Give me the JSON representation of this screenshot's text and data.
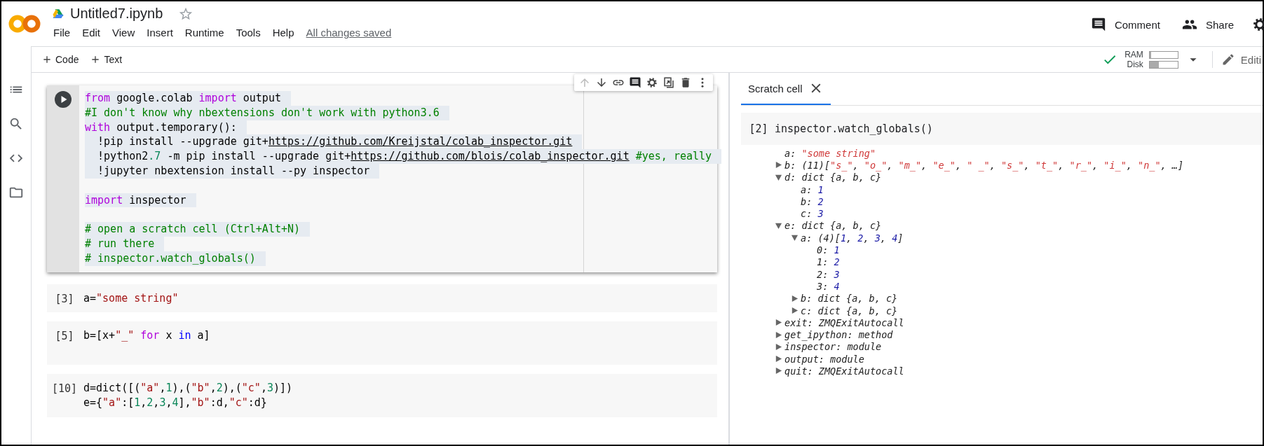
{
  "header": {
    "title": "Untitled7.ipynb",
    "starred": false,
    "menu": [
      "File",
      "Edit",
      "View",
      "Insert",
      "Runtime",
      "Tools",
      "Help"
    ],
    "save_status": "All changes saved",
    "actions": [
      {
        "label": "Comment",
        "kind": "comment"
      },
      {
        "label": "Share",
        "kind": "share"
      }
    ]
  },
  "toolbar": {
    "add_buttons": [
      "Code",
      "Text"
    ],
    "resources": [
      {
        "label": "RAM",
        "level": 0.06
      },
      {
        "label": "Disk",
        "level": 0.32
      }
    ],
    "mode": "Editi"
  },
  "notebook": {
    "cells": [
      {
        "kind": "active",
        "lines": [
          {
            "kind": "code",
            "tokens": [
              {
                "text": "from",
                "kind": "keyword"
              },
              {
                "text": " google.colab ",
                "kind": "plain"
              },
              {
                "text": "import",
                "kind": "keyword"
              },
              {
                "text": " output",
                "kind": "plain"
              }
            ]
          },
          {
            "kind": "code",
            "tokens": [
              {
                "text": "#I don't know why nbextensions don't work with python3.6",
                "kind": "comment"
              }
            ]
          },
          {
            "kind": "code",
            "tokens": [
              {
                "text": "with",
                "kind": "keyword"
              },
              {
                "text": " output.temporary():",
                "kind": "plain"
              }
            ]
          },
          {
            "kind": "code",
            "tokens": [
              {
                "text": "  !pip install --upgrade git+",
                "kind": "plain"
              },
              {
                "text": "https://github.com/Kreijstal/colab_inspector.git",
                "kind": "url"
              }
            ]
          },
          {
            "kind": "code",
            "tokens": [
              {
                "text": "  !python2",
                "kind": "plain"
              },
              {
                "text": ".7",
                "kind": "number"
              },
              {
                "text": " -m pip install --upgrade git+",
                "kind": "plain"
              },
              {
                "text": "https://github.com/blois/colab_inspector.git",
                "kind": "url"
              },
              {
                "text": " #yes, really",
                "kind": "comment"
              }
            ]
          },
          {
            "kind": "code",
            "tokens": [
              {
                "text": "  !jupyter nbextension install --py inspector",
                "kind": "plain"
              }
            ]
          },
          {
            "kind": "blank"
          },
          {
            "kind": "code",
            "tokens": [
              {
                "text": "import",
                "kind": "keyword"
              },
              {
                "text": " inspector",
                "kind": "plain"
              }
            ]
          },
          {
            "kind": "blank"
          },
          {
            "kind": "code",
            "tokens": [
              {
                "text": "# open a scratch cell (Ctrl+Alt+N)",
                "kind": "comment"
              }
            ]
          },
          {
            "kind": "code",
            "tokens": [
              {
                "text": "# run there",
                "kind": "comment"
              }
            ]
          },
          {
            "kind": "code",
            "tokens": [
              {
                "text": "# inspector.watch_globals()",
                "kind": "comment"
              }
            ]
          }
        ]
      },
      {
        "kind": "executed",
        "count": "[3]",
        "lines": [
          {
            "kind": "code",
            "tokens": [
              {
                "text": "a=",
                "kind": "plain"
              },
              {
                "text": "\"some string\"",
                "kind": "string"
              }
            ]
          }
        ]
      },
      {
        "kind": "executed",
        "count": "[5]",
        "lines": [
          {
            "kind": "code",
            "tokens": [
              {
                "text": "b=[x+",
                "kind": "plain"
              },
              {
                "text": "\"_\" ",
                "kind": "string"
              },
              {
                "text": "for",
                "kind": "keyword"
              },
              {
                "text": " x ",
                "kind": "plain"
              },
              {
                "text": "in",
                "kind": "operator"
              },
              {
                "text": " a]",
                "kind": "plain"
              }
            ]
          },
          {
            "kind": "blank"
          }
        ]
      },
      {
        "kind": "executed",
        "count": "[10]",
        "lines": [
          {
            "kind": "code",
            "tokens": [
              {
                "text": "d=dict([(",
                "kind": "plain"
              },
              {
                "text": "\"a\"",
                "kind": "string"
              },
              {
                "text": ",",
                "kind": "plain"
              },
              {
                "text": "1",
                "kind": "number"
              },
              {
                "text": "),(",
                "kind": "plain"
              },
              {
                "text": "\"b\"",
                "kind": "string"
              },
              {
                "text": ",",
                "kind": "plain"
              },
              {
                "text": "2",
                "kind": "number"
              },
              {
                "text": "),(",
                "kind": "plain"
              },
              {
                "text": "\"c\"",
                "kind": "string"
              },
              {
                "text": ",",
                "kind": "plain"
              },
              {
                "text": "3",
                "kind": "number"
              },
              {
                "text": ")])",
                "kind": "plain"
              }
            ]
          },
          {
            "kind": "code",
            "tokens": [
              {
                "text": "e={",
                "kind": "plain"
              },
              {
                "text": "\"a\"",
                "kind": "string"
              },
              {
                "text": ":[",
                "kind": "plain"
              },
              {
                "text": "1",
                "kind": "number"
              },
              {
                "text": ",",
                "kind": "plain"
              },
              {
                "text": "2",
                "kind": "number"
              },
              {
                "text": ",",
                "kind": "plain"
              },
              {
                "text": "3",
                "kind": "number"
              },
              {
                "text": ",",
                "kind": "plain"
              },
              {
                "text": "4",
                "kind": "number"
              },
              {
                "text": "],",
                "kind": "plain"
              },
              {
                "text": "\"b\"",
                "kind": "string"
              },
              {
                "text": ":d,",
                "kind": "plain"
              },
              {
                "text": "\"c\"",
                "kind": "string"
              },
              {
                "text": ":d}",
                "kind": "plain"
              }
            ]
          }
        ]
      }
    ]
  },
  "scratch_panel": {
    "tabs": [
      {
        "label": "Scratch cell",
        "selected": true
      }
    ],
    "cell": {
      "count": "[2]",
      "code": "inspector.watch_globals()"
    },
    "inspector": [
      {
        "key": "a:",
        "kind": "leaf",
        "value": [
          {
            "text": "\"some string\"",
            "kind": "string"
          }
        ]
      },
      {
        "key": "b:",
        "kind": "branch",
        "expanded": false,
        "value": [
          {
            "text": "(11)[",
            "kind": "type"
          },
          {
            "text": "\"s_\"",
            "kind": "string"
          },
          {
            "text": ", ",
            "kind": "type"
          },
          {
            "text": "\"o_\"",
            "kind": "string"
          },
          {
            "text": ", ",
            "kind": "type"
          },
          {
            "text": "\"m_\"",
            "kind": "string"
          },
          {
            "text": ", ",
            "kind": "type"
          },
          {
            "text": "\"e_\"",
            "kind": "string"
          },
          {
            "text": ", ",
            "kind": "type"
          },
          {
            "text": "\" _\"",
            "kind": "string"
          },
          {
            "text": ", ",
            "kind": "type"
          },
          {
            "text": "\"s_\"",
            "kind": "string"
          },
          {
            "text": ", ",
            "kind": "type"
          },
          {
            "text": "\"t_\"",
            "kind": "string"
          },
          {
            "text": ", ",
            "kind": "type"
          },
          {
            "text": "\"r_\"",
            "kind": "string"
          },
          {
            "text": ", ",
            "kind": "type"
          },
          {
            "text": "\"i_\"",
            "kind": "string"
          },
          {
            "text": ", ",
            "kind": "type"
          },
          {
            "text": "\"n_\"",
            "kind": "string"
          },
          {
            "text": ", …]",
            "kind": "type"
          }
        ]
      },
      {
        "key": "d:",
        "kind": "branch",
        "expanded": true,
        "value": [
          {
            "text": "dict {a, b, c}",
            "kind": "type"
          }
        ],
        "children": [
          {
            "key": "a:",
            "kind": "leaf",
            "value": [
              {
                "text": "1",
                "kind": "number"
              }
            ]
          },
          {
            "key": "b:",
            "kind": "leaf",
            "value": [
              {
                "text": "2",
                "kind": "number"
              }
            ]
          },
          {
            "key": "c:",
            "kind": "leaf",
            "value": [
              {
                "text": "3",
                "kind": "number"
              }
            ]
          }
        ]
      },
      {
        "key": "e:",
        "kind": "branch",
        "expanded": true,
        "value": [
          {
            "text": "dict {a, b, c}",
            "kind": "type"
          }
        ],
        "children": [
          {
            "key": "a:",
            "kind": "branch",
            "expanded": true,
            "value": [
              {
                "text": "(4)[",
                "kind": "type"
              },
              {
                "text": "1",
                "kind": "number"
              },
              {
                "text": ", ",
                "kind": "type"
              },
              {
                "text": "2",
                "kind": "number"
              },
              {
                "text": ", ",
                "kind": "type"
              },
              {
                "text": "3",
                "kind": "number"
              },
              {
                "text": ", ",
                "kind": "type"
              },
              {
                "text": "4",
                "kind": "number"
              },
              {
                "text": "]",
                "kind": "type"
              }
            ],
            "children": [
              {
                "key": "0:",
                "kind": "leaf",
                "value": [
                  {
                    "text": "1",
                    "kind": "number"
                  }
                ]
              },
              {
                "key": "1:",
                "kind": "leaf",
                "value": [
                  {
                    "text": "2",
                    "kind": "number"
                  }
                ]
              },
              {
                "key": "2:",
                "kind": "leaf",
                "value": [
                  {
                    "text": "3",
                    "kind": "number"
                  }
                ]
              },
              {
                "key": "3:",
                "kind": "leaf",
                "value": [
                  {
                    "text": "4",
                    "kind": "number"
                  }
                ]
              }
            ]
          },
          {
            "key": "b:",
            "kind": "branch",
            "expanded": false,
            "value": [
              {
                "text": "dict {a, b, c}",
                "kind": "type"
              }
            ]
          },
          {
            "key": "c:",
            "kind": "branch",
            "expanded": false,
            "value": [
              {
                "text": "dict {a, b, c}",
                "kind": "type"
              }
            ]
          }
        ]
      },
      {
        "key": "exit:",
        "kind": "branch",
        "expanded": false,
        "value": [
          {
            "text": "ZMQExitAutocall",
            "kind": "type"
          }
        ]
      },
      {
        "key": "get_ipython:",
        "kind": "branch",
        "expanded": false,
        "value": [
          {
            "text": "method",
            "kind": "type"
          }
        ]
      },
      {
        "key": "inspector:",
        "kind": "branch",
        "expanded": false,
        "value": [
          {
            "text": "module",
            "kind": "type"
          }
        ]
      },
      {
        "key": "output:",
        "kind": "branch",
        "expanded": false,
        "value": [
          {
            "text": "module",
            "kind": "type"
          }
        ]
      },
      {
        "key": "quit:",
        "kind": "branch",
        "expanded": false,
        "value": [
          {
            "text": "ZMQExitAutocall",
            "kind": "type"
          }
        ]
      }
    ]
  }
}
